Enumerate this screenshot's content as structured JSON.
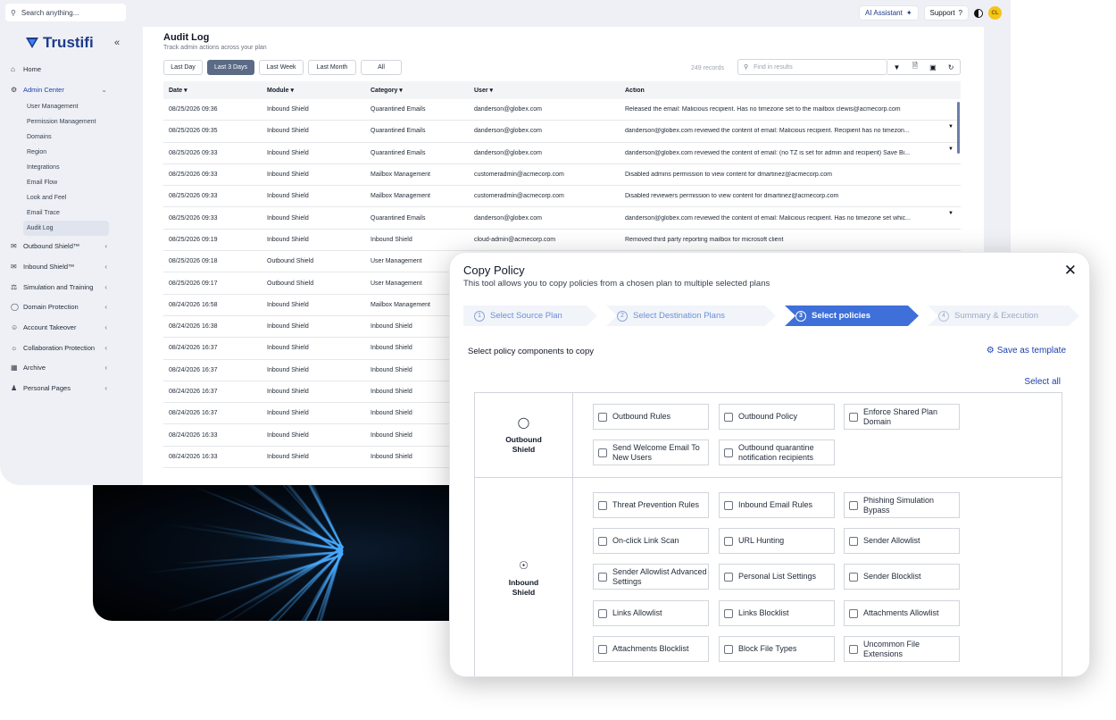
{
  "topbar": {
    "search_placeholder": "Search anything...",
    "ai_assistant": "AI Assistant",
    "support": "Support",
    "avatar_initials": "CL"
  },
  "brand": {
    "name": "Trustifi",
    "color": "#1e3a8a"
  },
  "sidebar": {
    "home": "Home",
    "admin_center": "Admin Center",
    "admin_sub": [
      "User Management",
      "Permission Management",
      "Domains",
      "Region",
      "Integrations",
      "Email Flow",
      "Look and Feel",
      "Email Trace",
      "Audit Log"
    ],
    "sections": [
      "Outbound Shield™",
      "Inbound Shield™",
      "Simulation and Training",
      "Domain Protection",
      "Account Takeover",
      "Collaboration Protection",
      "Archive",
      "Personal Pages"
    ]
  },
  "audit": {
    "title": "Audit Log",
    "subtitle": "Track admin actions across your plan",
    "filters": [
      "Last Day",
      "Last 3 Days",
      "Last Week",
      "Last Month",
      "All"
    ],
    "active_filter": "Last 3 Days",
    "records": "249 records",
    "find_placeholder": "Find in results",
    "columns": [
      "Date",
      "Module",
      "Category",
      "User",
      "Action"
    ],
    "rows": [
      [
        "08/25/2026 09:36",
        "Inbound Shield",
        "Quarantined Emails",
        "danderson@globex.com",
        "Released the email: Malicious recipient. Has no timezone set to the mailbox clewis@acmecorp.com"
      ],
      [
        "08/25/2026 09:35",
        "Inbound Shield",
        "Quarantined Emails",
        "danderson@globex.com",
        "danderson@globex.com reviewed the content of email: Malicious recipient. Recipient has no timezon..."
      ],
      [
        "08/25/2026 09:33",
        "Inbound Shield",
        "Quarantined Emails",
        "danderson@globex.com",
        "danderson@globex.com reviewed the content of email: (no TZ is set for admin and recipient) Save Bi..."
      ],
      [
        "08/25/2026 09:33",
        "Inbound Shield",
        "Mailbox Management",
        "customeradmin@acmecorp.com",
        "Disabled admins permission to view content for dmartinez@acmecorp.com"
      ],
      [
        "08/25/2026 09:33",
        "Inbound Shield",
        "Mailbox Management",
        "customeradmin@acmecorp.com",
        "Disabled reviewers permission to view content for dmartinez@acmecorp.com"
      ],
      [
        "08/25/2026 09:33",
        "Inbound Shield",
        "Quarantined Emails",
        "danderson@globex.com",
        "danderson@globex.com reviewed the content of email: Malicious recipient. Has no timezone set whic..."
      ],
      [
        "08/25/2026 09:19",
        "Inbound Shield",
        "Inbound Shield",
        "cloud-admin@acmecorp.com",
        "Removed third party reporting mailbox for microsoft client"
      ],
      [
        "08/25/2026 09:18",
        "Outbound Shield",
        "User Management",
        "",
        ""
      ],
      [
        "08/25/2026 09:17",
        "Outbound Shield",
        "User Management",
        "",
        ""
      ],
      [
        "08/24/2026 16:58",
        "Inbound Shield",
        "Mailbox Management",
        "",
        ""
      ],
      [
        "08/24/2026 16:38",
        "Inbound Shield",
        "Inbound Shield",
        "",
        ""
      ],
      [
        "08/24/2026 16:37",
        "Inbound Shield",
        "Inbound Shield",
        "",
        ""
      ],
      [
        "08/24/2026 16:37",
        "Inbound Shield",
        "Inbound Shield",
        "",
        ""
      ],
      [
        "08/24/2026 16:37",
        "Inbound Shield",
        "Inbound Shield",
        "",
        ""
      ],
      [
        "08/24/2026 16:37",
        "Inbound Shield",
        "Inbound Shield",
        "",
        ""
      ],
      [
        "08/24/2026 16:33",
        "Inbound Shield",
        "Inbound Shield",
        "",
        ""
      ],
      [
        "08/24/2026 16:33",
        "Inbound Shield",
        "Inbound Shield",
        "",
        ""
      ]
    ]
  },
  "modal": {
    "title": "Copy Policy",
    "description": "This tool allows you to copy policies from a chosen plan to multiple selected plans",
    "steps": [
      "Select Source Plan",
      "Select Destination Plans",
      "Select policies",
      "Summary & Execution"
    ],
    "active_step": 3,
    "select_label": "Select policy components to copy",
    "save_template": "Save as template",
    "select_all": "Select all",
    "sections": [
      {
        "label": "Outbound Shield",
        "options": [
          "Outbound Rules",
          "Outbound Policy",
          "Enforce Shared Plan Domain",
          "Send Welcome Email To New Users",
          "Outbound quarantine notification recipients"
        ]
      },
      {
        "label": "Inbound Shield",
        "options": [
          "Threat Prevention Rules",
          "Inbound Email Rules",
          "Phishing Simulation Bypass",
          "On-click Link Scan",
          "URL Hunting",
          "Sender Allowlist",
          "Sender Allowlist Advanced Settings",
          "Personal List Settings",
          "Sender Blocklist",
          "Links Allowlist",
          "Links Blocklist",
          "Attachments Allowlist",
          "Attachments Blocklist",
          "Block File Types",
          "Uncommon File Extensions"
        ]
      }
    ]
  },
  "colors": {
    "accent": "#3f6fd8",
    "link": "#1e40af"
  }
}
